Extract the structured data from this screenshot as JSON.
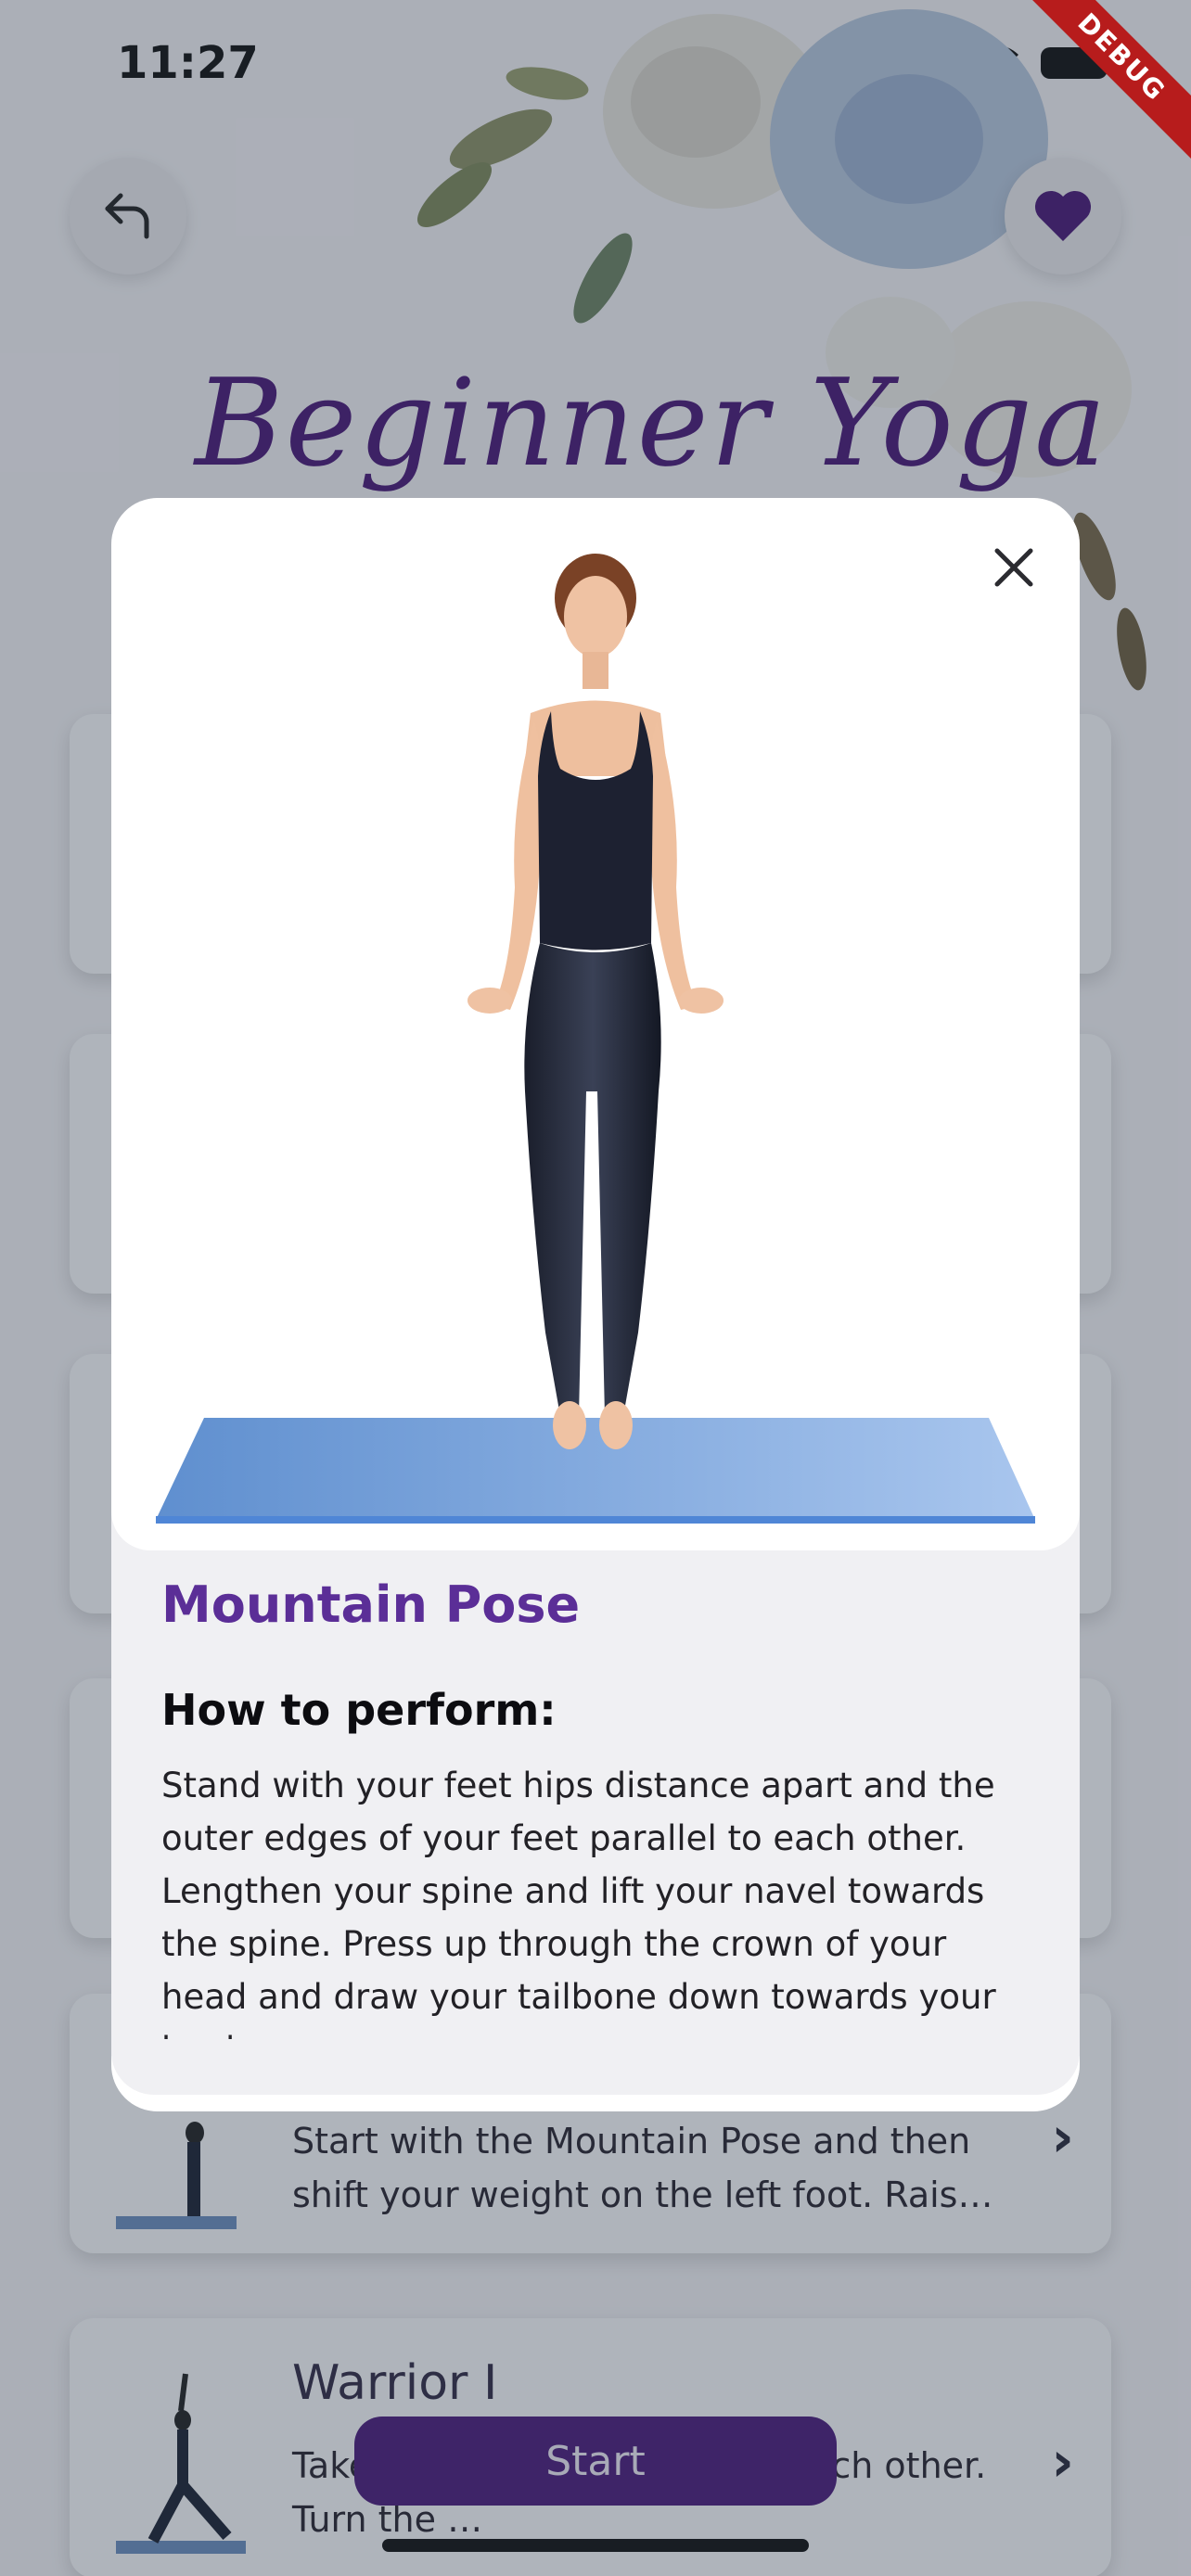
{
  "status_bar": {
    "time": "11:27"
  },
  "debug_label": "DEBUG",
  "header": {
    "title": "Beginner Yoga"
  },
  "cards": [
    {
      "title": "",
      "description": "Start with the Mountain Pose and then shift your weight on the left foot. Rais…"
    },
    {
      "title": "Warrior I",
      "description": "Take … your feet parallel to each other.  Turn the …"
    }
  ],
  "start_button": {
    "label": "Start"
  },
  "modal": {
    "pose_name": "Mountain Pose",
    "how_to_heading": "How to perform:",
    "how_to_text": "Stand with your feet hips distance apart and the outer edges of your feet parallel to each other. Lengthen your spine and lift your navel towards the spine. Press up through the crown of your head and draw your tailbone down towards your heels."
  },
  "icons": {
    "back": "back-arrow-icon",
    "favorite": "heart-icon",
    "close": "close-icon",
    "chevron": "chevron-right-icon"
  },
  "colors": {
    "brand_purple": "#4b1b7c",
    "title_purple": "#5b2e97",
    "heart": "#4a1877",
    "mat_blue": "#7da7dd"
  }
}
